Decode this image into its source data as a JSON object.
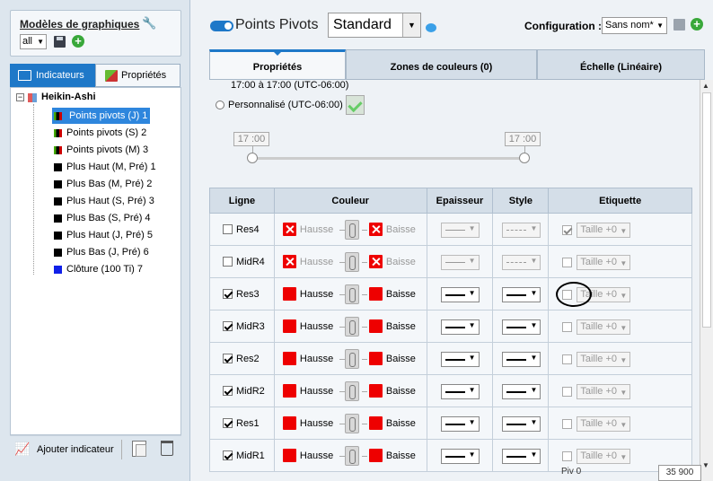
{
  "left": {
    "templates_title": "Modèles de graphiques",
    "filter_value": "all",
    "tabs": [
      {
        "label": "Indicateurs"
      },
      {
        "label": "Propriétés"
      }
    ],
    "tree": {
      "root": "Heikin-Ashi",
      "items": [
        {
          "label": "Points pivots (J) 1",
          "icon": "pivot",
          "selected": true
        },
        {
          "label": "Points pivots (S) 2",
          "icon": "pivot"
        },
        {
          "label": "Points pivots (M) 3",
          "icon": "pivot"
        },
        {
          "label": "Plus Haut (M, Pré) 1",
          "icon": "black"
        },
        {
          "label": "Plus Bas (M, Pré) 2",
          "icon": "black"
        },
        {
          "label": "Plus Haut (S, Pré) 3",
          "icon": "black"
        },
        {
          "label": "Plus Bas (S, Pré) 4",
          "icon": "black"
        },
        {
          "label": "Plus Haut (J, Pré) 5",
          "icon": "black"
        },
        {
          "label": "Plus Bas (J, Pré) 6",
          "icon": "black"
        },
        {
          "label": "Clôture (100 Ti) 7",
          "icon": "blue"
        }
      ]
    },
    "add_indicator": "Ajouter indicateur"
  },
  "header": {
    "title": "Points Pivots",
    "style_value": "Standard",
    "config_label": "Configuration :",
    "config_value": "Sans nom*"
  },
  "tabs": [
    {
      "label": "Propriétés"
    },
    {
      "label": "Zones de couleurs (0)"
    },
    {
      "label": "Échelle (Linéaire)"
    }
  ],
  "session": {
    "time_range": "17:00 à 17:00 (UTC-06:00)",
    "custom_label": "Personnalisé (UTC-06:00)",
    "start_time": "17 :00",
    "end_time": "17 :00"
  },
  "table": {
    "headers": [
      "Ligne",
      "Couleur",
      "Epaisseur",
      "Style",
      "Etiquette"
    ],
    "up_label": "Hausse",
    "down_label": "Baisse",
    "size_label": "Taille +0",
    "rows": [
      {
        "name": "Res4",
        "checked": false,
        "enabled": false,
        "label_checked": true
      },
      {
        "name": "MidR4",
        "checked": false,
        "enabled": false,
        "label_checked": false
      },
      {
        "name": "Res3",
        "checked": true,
        "enabled": true,
        "label_checked": false
      },
      {
        "name": "MidR3",
        "checked": true,
        "enabled": true,
        "label_checked": false
      },
      {
        "name": "Res2",
        "checked": true,
        "enabled": true,
        "label_checked": false
      },
      {
        "name": "MidR2",
        "checked": true,
        "enabled": true,
        "label_checked": false
      },
      {
        "name": "Res1",
        "checked": true,
        "enabled": true,
        "label_checked": false
      },
      {
        "name": "MidR1",
        "checked": true,
        "enabled": true,
        "label_checked": false
      }
    ]
  },
  "fragments": {
    "bottom_value": "35 900",
    "bottom_text": "Piv 0"
  },
  "colors": {
    "accent": "#1e78c8",
    "swatch_red": "#e00000",
    "add_green": "#39a83a"
  }
}
